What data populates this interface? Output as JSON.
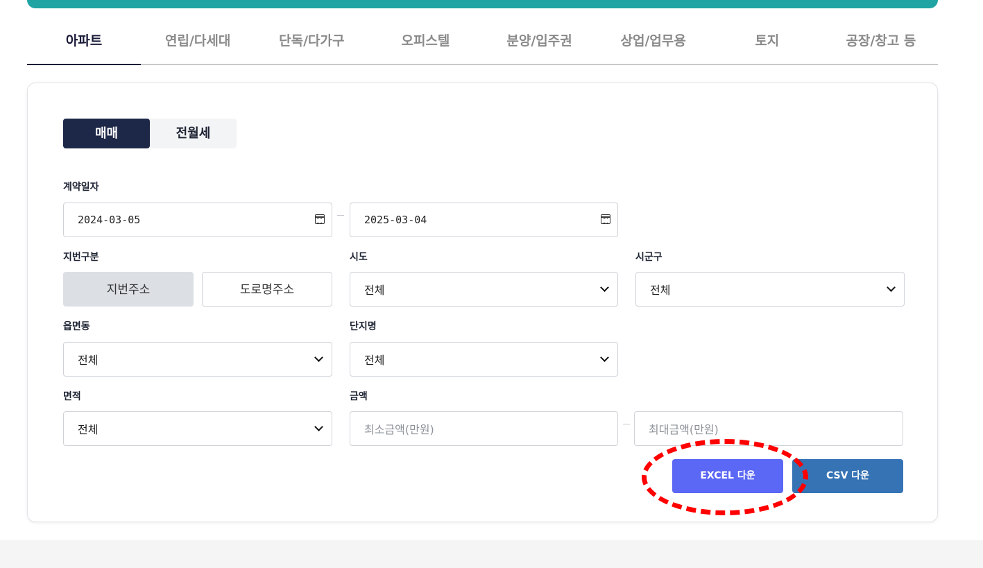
{
  "tabs": [
    {
      "label": "아파트",
      "active": true
    },
    {
      "label": "연립/다세대",
      "active": false
    },
    {
      "label": "단독/다가구",
      "active": false
    },
    {
      "label": "오피스텔",
      "active": false
    },
    {
      "label": "분양/입주권",
      "active": false
    },
    {
      "label": "상업/업무용",
      "active": false
    },
    {
      "label": "토지",
      "active": false
    },
    {
      "label": "공장/창고 등",
      "active": false
    }
  ],
  "trade_type": {
    "sale": "매매",
    "rent": "전월세",
    "selected": "매매"
  },
  "contract_date": {
    "label": "계약일자",
    "start": "2024-03-05",
    "end": "2025-03-04"
  },
  "lot_type": {
    "label": "지번구분",
    "lot_address": "지번주소",
    "road_address": "도로명주소",
    "selected": "지번주소"
  },
  "sido": {
    "label": "시도",
    "value": "전체"
  },
  "sigungu": {
    "label": "시군구",
    "value": "전체"
  },
  "eupmyeondong": {
    "label": "읍면동",
    "value": "전체"
  },
  "complex": {
    "label": "단지명",
    "value": "전체"
  },
  "area": {
    "label": "면적",
    "value": "전체"
  },
  "amount": {
    "label": "금액",
    "min_placeholder": "최소금액(만원)",
    "max_placeholder": "최대금액(만원)"
  },
  "downloads": {
    "excel": "EXCEL 다운",
    "csv": "CSV 다운"
  },
  "colors": {
    "teal": "#1fa3a3",
    "navy": "#1d2747",
    "excel_button": "#5b67f5",
    "csv_button": "#3673b4",
    "annotation": "#ff0000"
  }
}
